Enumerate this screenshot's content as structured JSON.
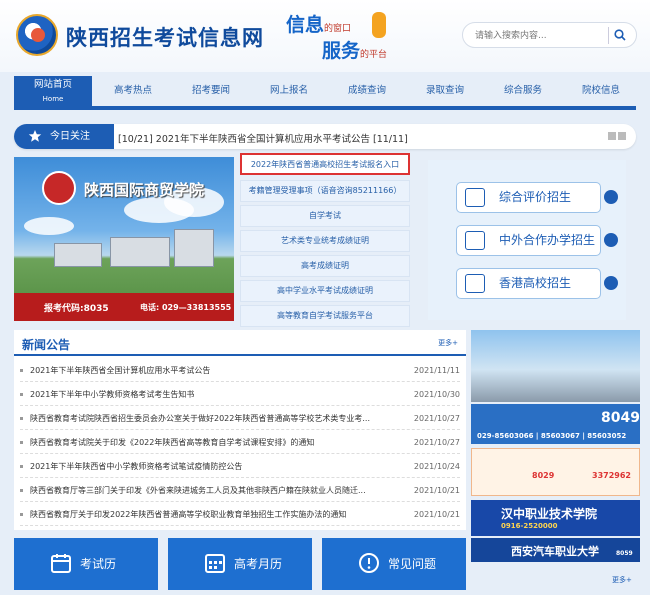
{
  "site": {
    "title": "陕西招生考试信息网",
    "slogan_line1_main": "信息",
    "slogan_line1_sub": "的窗口",
    "slogan_line2_main": "服务",
    "slogan_line2_sub": "的平台"
  },
  "search": {
    "placeholder": "请输入搜索内容..."
  },
  "nav": {
    "items": [
      {
        "label": "网站首页",
        "sub": "Home"
      },
      {
        "label": "高考热点"
      },
      {
        "label": "招考要闻"
      },
      {
        "label": "网上报名"
      },
      {
        "label": "成绩查询"
      },
      {
        "label": "录取查询"
      },
      {
        "label": "综合服务"
      },
      {
        "label": "院校信息"
      }
    ]
  },
  "notice": {
    "heading": "今日关注",
    "text": "[10/21]  2021年下半年陕西省全国计算机应用水平考试公告 [11/11]"
  },
  "banner": {
    "school": "陕西国际商贸学院",
    "code": "报考代码:8035",
    "tel": "电话: 029—33813555"
  },
  "quick_links": [
    "2022年陕西省普通高校招生考试报名入口",
    "考籍管理受理事项（语音咨询85211166）",
    "自学考试",
    "艺术类专业统考成绩证明",
    "高考成绩证明",
    "高中学业水平考试成绩证明",
    "高等教育自学考试服务平台"
  ],
  "promos": [
    "综合评价招生",
    "中外合作办学招生",
    "香港高校招生"
  ],
  "news": {
    "title": "新闻公告",
    "more": "更多+",
    "items": [
      {
        "text": "2021年下半年陕西省全国计算机应用水平考试公告",
        "date": "2021/11/11"
      },
      {
        "text": "2021年下半年中小学教师资格考试考生告知书",
        "date": "2021/10/30"
      },
      {
        "text": "陕西省教育考试院陕西省招生委员会办公室关于做好2022年陕西省普通高等学校艺术类专业考...",
        "date": "2021/10/27"
      },
      {
        "text": "陕西省教育考试院关于印发《2022年陕西省高等教育自学考试课程安排》的通知",
        "date": "2021/10/27"
      },
      {
        "text": "2021年下半年陕西省中小学教师资格考试笔试疫情防控公告",
        "date": "2021/10/24"
      },
      {
        "text": "陕西省教育厅等三部门关于印发《外省来陕进城务工人员及其他非陕西户籍在陕就业人员随迁...",
        "date": "2021/10/21"
      },
      {
        "text": "陕西省教育厅关于印发2022年陕西省普通高等学校职业教育单独招生工作实施办法的通知",
        "date": "2021/10/21"
      }
    ]
  },
  "side_ads": {
    "code1": "8049",
    "phone1": "029-85603066 | 85603067 | 85603052",
    "school_a": "西安汽车职业大学",
    "code_b": "8029",
    "phone_b": "3372962",
    "school_c": "汉中职业技术学院",
    "phone_c": "0916-2520000",
    "school_d": "西安汽车职业大学",
    "code_d": "8059",
    "more": "更多+"
  },
  "bottom_buttons": [
    "考试历",
    "高考月历",
    "常见问题"
  ],
  "colors": {
    "primary": "#1d5db4",
    "accent_red": "#d33"
  }
}
